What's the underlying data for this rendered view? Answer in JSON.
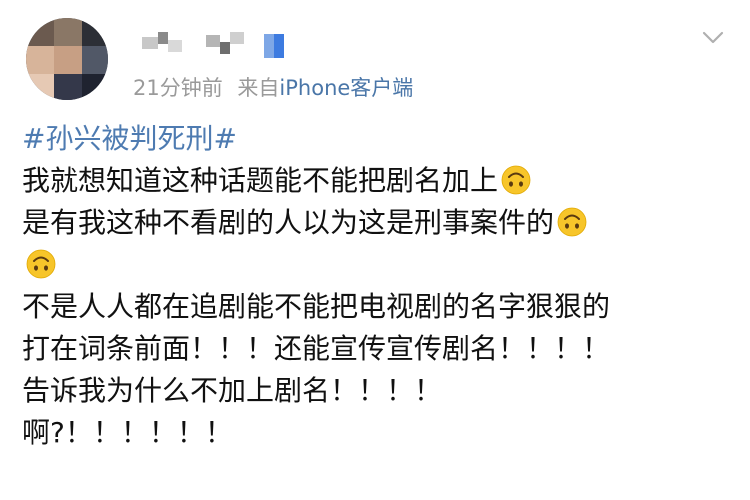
{
  "post": {
    "username": "",
    "time": "21分钟前",
    "source_prefix": "来自",
    "source": "iPhone客户端",
    "topic": "#孙兴被判死刑#",
    "lines": [
      "我就想知道这种话题能不能把剧名加上",
      "是有我这种不看剧的人以为这是刑事案件的",
      "",
      "不是人人都在追剧能不能把电视剧的名字狠狠的",
      "打在词条前面！！！还能宣传宣传剧名！！！！",
      "告诉我为什么不加上剧名！！！！",
      "啊?！！！！！！"
    ],
    "emoji_icon": "upside-down-face-emoji",
    "menu_icon": "chevron-down-icon"
  },
  "colors": {
    "link": "#4e7bb1",
    "meta": "#9a9a9a",
    "text": "#111111",
    "emoji": "#f7c52a"
  }
}
